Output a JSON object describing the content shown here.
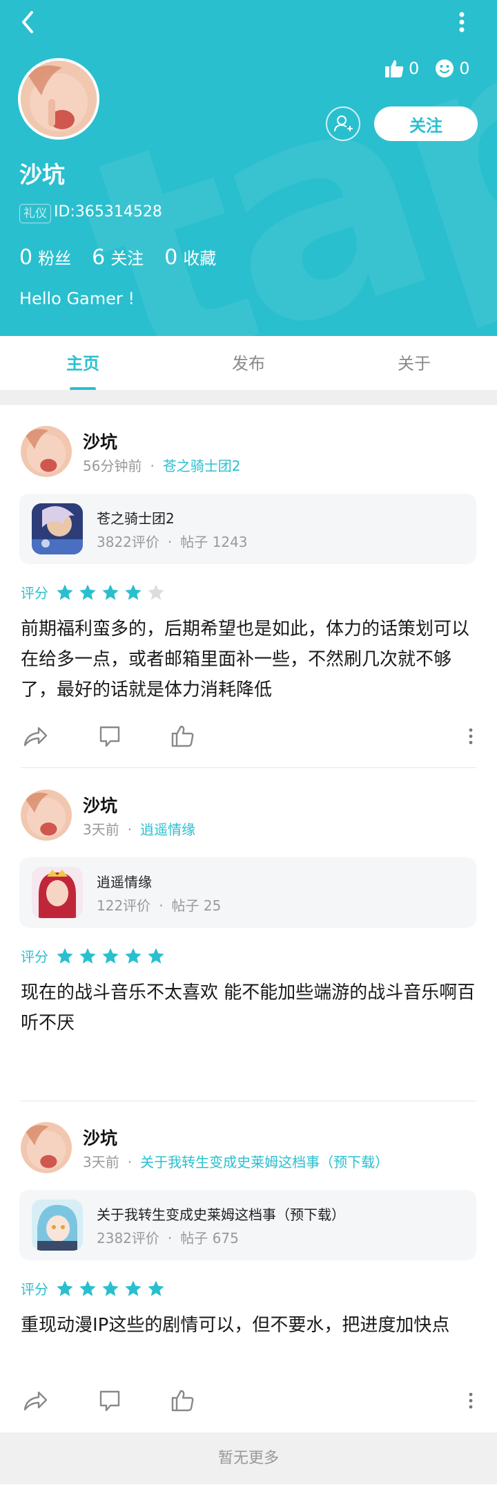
{
  "profile": {
    "name": "沙坑",
    "badge": "礼仪",
    "id_text": "ID:365314528",
    "likes_count": "0",
    "emoji_count": "0",
    "follow_label": "关注",
    "bio": "Hello Gamer !",
    "stats": [
      {
        "num": "0",
        "label": "粉丝"
      },
      {
        "num": "6",
        "label": "关注"
      },
      {
        "num": "0",
        "label": "收藏"
      }
    ]
  },
  "tabs": [
    "主页",
    "发布",
    "关于"
  ],
  "active_tab": 0,
  "colors": {
    "accent": "#2abfce",
    "star_empty": "#dddddd"
  },
  "posts": [
    {
      "author": "沙坑",
      "time": "56分钟前",
      "game": "苍之骑士团2",
      "card_title": "苍之骑士团2",
      "card_reviews": "3822评价",
      "card_posts": "帖子 1243",
      "rating_label": "评分",
      "stars": 4,
      "text": "前期福利蛮多的，后期希望也是如此，体力的话策划可以在给多一点，或者邮箱里面补一些，不然刷几次就不够了，最好的话就是体力消耗降低"
    },
    {
      "author": "沙坑",
      "time": "3天前",
      "game": "逍遥情缘",
      "card_title": "逍遥情缘",
      "card_reviews": "122评价",
      "card_posts": "帖子 25",
      "rating_label": "评分",
      "stars": 5,
      "text": "现在的战斗音乐不太喜欢 能不能加些端游的战斗音乐啊百听不厌"
    },
    {
      "author": "沙坑",
      "time": "3天前",
      "game": "关于我转生变成史莱姆这档事（预下载）",
      "card_title": "关于我转生变成史莱姆这档事（预下载）",
      "card_reviews": "2382评价",
      "card_posts": "帖子 675",
      "rating_label": "评分",
      "stars": 5,
      "text": "重现动漫IP这些的剧情可以，但不要水，把进度加快点"
    }
  ],
  "footer_text": "暂无更多"
}
